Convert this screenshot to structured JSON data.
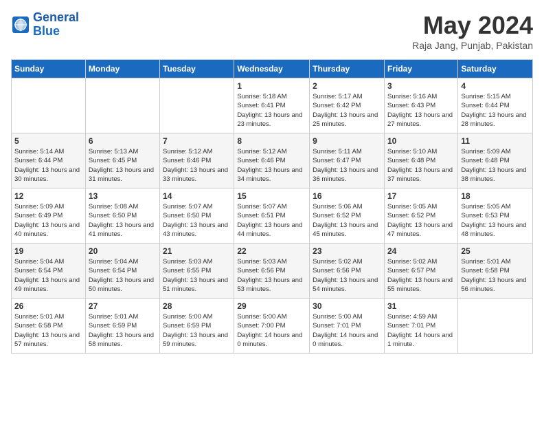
{
  "header": {
    "logo_line1": "General",
    "logo_line2": "Blue",
    "month": "May 2024",
    "location": "Raja Jang, Punjab, Pakistan"
  },
  "days_of_week": [
    "Sunday",
    "Monday",
    "Tuesday",
    "Wednesday",
    "Thursday",
    "Friday",
    "Saturday"
  ],
  "weeks": [
    [
      {
        "num": "",
        "info": ""
      },
      {
        "num": "",
        "info": ""
      },
      {
        "num": "",
        "info": ""
      },
      {
        "num": "1",
        "info": "Sunrise: 5:18 AM\nSunset: 6:41 PM\nDaylight: 13 hours\nand 23 minutes."
      },
      {
        "num": "2",
        "info": "Sunrise: 5:17 AM\nSunset: 6:42 PM\nDaylight: 13 hours\nand 25 minutes."
      },
      {
        "num": "3",
        "info": "Sunrise: 5:16 AM\nSunset: 6:43 PM\nDaylight: 13 hours\nand 27 minutes."
      },
      {
        "num": "4",
        "info": "Sunrise: 5:15 AM\nSunset: 6:44 PM\nDaylight: 13 hours\nand 28 minutes."
      }
    ],
    [
      {
        "num": "5",
        "info": "Sunrise: 5:14 AM\nSunset: 6:44 PM\nDaylight: 13 hours\nand 30 minutes."
      },
      {
        "num": "6",
        "info": "Sunrise: 5:13 AM\nSunset: 6:45 PM\nDaylight: 13 hours\nand 31 minutes."
      },
      {
        "num": "7",
        "info": "Sunrise: 5:12 AM\nSunset: 6:46 PM\nDaylight: 13 hours\nand 33 minutes."
      },
      {
        "num": "8",
        "info": "Sunrise: 5:12 AM\nSunset: 6:46 PM\nDaylight: 13 hours\nand 34 minutes."
      },
      {
        "num": "9",
        "info": "Sunrise: 5:11 AM\nSunset: 6:47 PM\nDaylight: 13 hours\nand 36 minutes."
      },
      {
        "num": "10",
        "info": "Sunrise: 5:10 AM\nSunset: 6:48 PM\nDaylight: 13 hours\nand 37 minutes."
      },
      {
        "num": "11",
        "info": "Sunrise: 5:09 AM\nSunset: 6:48 PM\nDaylight: 13 hours\nand 38 minutes."
      }
    ],
    [
      {
        "num": "12",
        "info": "Sunrise: 5:09 AM\nSunset: 6:49 PM\nDaylight: 13 hours\nand 40 minutes."
      },
      {
        "num": "13",
        "info": "Sunrise: 5:08 AM\nSunset: 6:50 PM\nDaylight: 13 hours\nand 41 minutes."
      },
      {
        "num": "14",
        "info": "Sunrise: 5:07 AM\nSunset: 6:50 PM\nDaylight: 13 hours\nand 43 minutes."
      },
      {
        "num": "15",
        "info": "Sunrise: 5:07 AM\nSunset: 6:51 PM\nDaylight: 13 hours\nand 44 minutes."
      },
      {
        "num": "16",
        "info": "Sunrise: 5:06 AM\nSunset: 6:52 PM\nDaylight: 13 hours\nand 45 minutes."
      },
      {
        "num": "17",
        "info": "Sunrise: 5:05 AM\nSunset: 6:52 PM\nDaylight: 13 hours\nand 47 minutes."
      },
      {
        "num": "18",
        "info": "Sunrise: 5:05 AM\nSunset: 6:53 PM\nDaylight: 13 hours\nand 48 minutes."
      }
    ],
    [
      {
        "num": "19",
        "info": "Sunrise: 5:04 AM\nSunset: 6:54 PM\nDaylight: 13 hours\nand 49 minutes."
      },
      {
        "num": "20",
        "info": "Sunrise: 5:04 AM\nSunset: 6:54 PM\nDaylight: 13 hours\nand 50 minutes."
      },
      {
        "num": "21",
        "info": "Sunrise: 5:03 AM\nSunset: 6:55 PM\nDaylight: 13 hours\nand 51 minutes."
      },
      {
        "num": "22",
        "info": "Sunrise: 5:03 AM\nSunset: 6:56 PM\nDaylight: 13 hours\nand 53 minutes."
      },
      {
        "num": "23",
        "info": "Sunrise: 5:02 AM\nSunset: 6:56 PM\nDaylight: 13 hours\nand 54 minutes."
      },
      {
        "num": "24",
        "info": "Sunrise: 5:02 AM\nSunset: 6:57 PM\nDaylight: 13 hours\nand 55 minutes."
      },
      {
        "num": "25",
        "info": "Sunrise: 5:01 AM\nSunset: 6:58 PM\nDaylight: 13 hours\nand 56 minutes."
      }
    ],
    [
      {
        "num": "26",
        "info": "Sunrise: 5:01 AM\nSunset: 6:58 PM\nDaylight: 13 hours\nand 57 minutes."
      },
      {
        "num": "27",
        "info": "Sunrise: 5:01 AM\nSunset: 6:59 PM\nDaylight: 13 hours\nand 58 minutes."
      },
      {
        "num": "28",
        "info": "Sunrise: 5:00 AM\nSunset: 6:59 PM\nDaylight: 13 hours\nand 59 minutes."
      },
      {
        "num": "29",
        "info": "Sunrise: 5:00 AM\nSunset: 7:00 PM\nDaylight: 14 hours\nand 0 minutes."
      },
      {
        "num": "30",
        "info": "Sunrise: 5:00 AM\nSunset: 7:01 PM\nDaylight: 14 hours\nand 0 minutes."
      },
      {
        "num": "31",
        "info": "Sunrise: 4:59 AM\nSunset: 7:01 PM\nDaylight: 14 hours\nand 1 minute."
      },
      {
        "num": "",
        "info": ""
      }
    ]
  ]
}
